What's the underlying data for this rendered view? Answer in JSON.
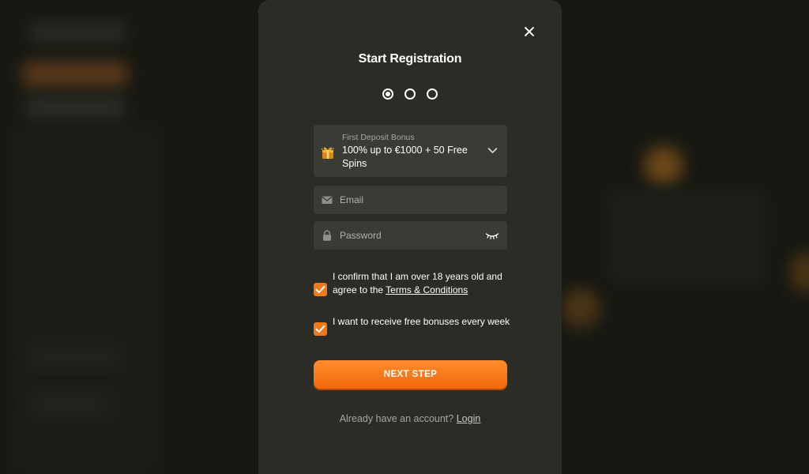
{
  "modal": {
    "title": "Start Registration",
    "steps_total": 3,
    "current_step": 1,
    "close_icon": "close-icon"
  },
  "bonus": {
    "label": "First Deposit Bonus",
    "value": "100% up to €1000 + 50 Free Spins",
    "icon": "gift-icon",
    "dropdown_icon": "chevron-down-icon"
  },
  "email": {
    "placeholder": "Email",
    "value": "",
    "icon": "envelope-icon"
  },
  "password": {
    "placeholder": "Password",
    "value": "",
    "icon": "lock-icon",
    "toggle_icon": "eye-closed-icon"
  },
  "consent": {
    "age_text": "I confirm that I am over 18 years old and agree to the ",
    "terms_link": "Terms & Conditions",
    "age_checked": true,
    "bonuses_text": "I want to receive free bonuses every week",
    "bonuses_checked": true
  },
  "next_button": "NEXT STEP",
  "login": {
    "prompt": "Already have an account? ",
    "link": "Login"
  },
  "colors": {
    "accent": "#f07a1a",
    "modal_bg": "#2b2c26",
    "field_bg": "#3a3b35"
  }
}
